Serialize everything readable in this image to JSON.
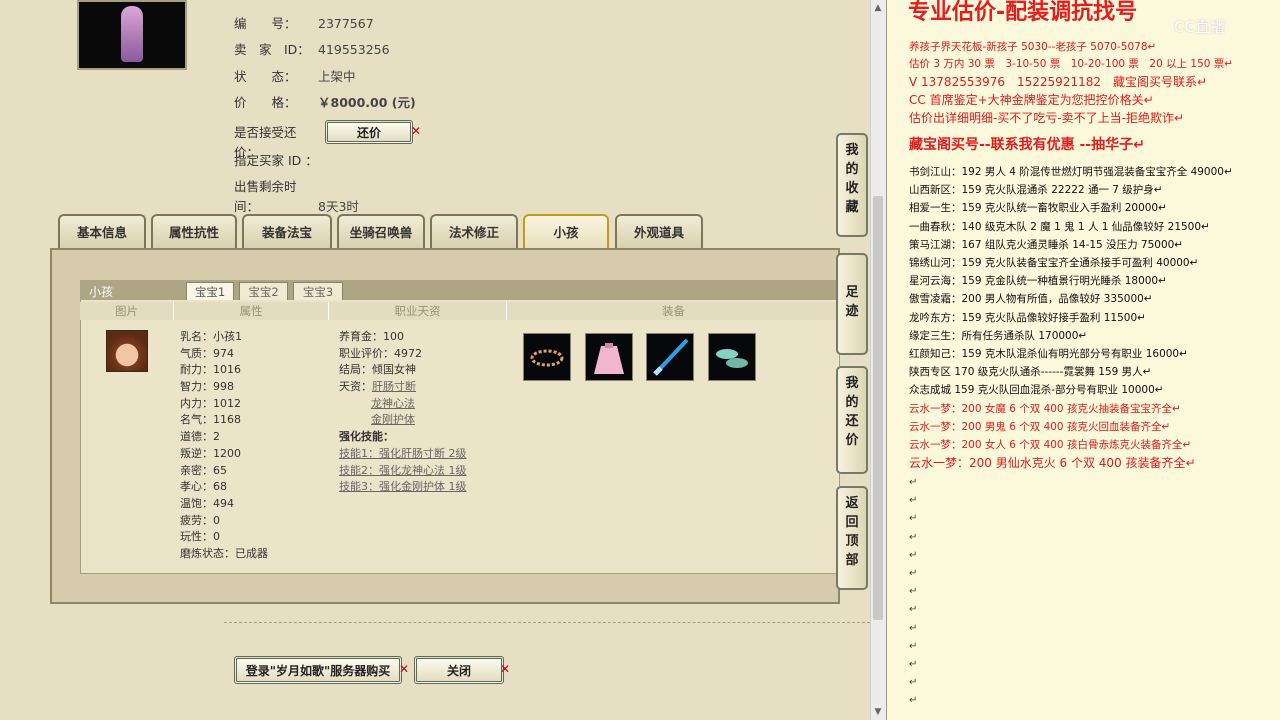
{
  "info": {
    "id_label": "编　　号：",
    "id_value": "2377567",
    "seller_label": "卖　家　ID：",
    "seller_value": "419553256",
    "status_label": "状　　态：",
    "status_value": "上架中",
    "price_label": "价　　格：",
    "price_value": "￥8000.00 (元)",
    "accept_label": "是否接受还价：",
    "counter_btn": "还价",
    "buyer_label": "指定买家 ID ：",
    "remain_label": "出售剩余时间：",
    "remain_value": "8天3时"
  },
  "tabs": [
    "基本信息",
    "属性抗性",
    "装备法宝",
    "坐骑召唤兽",
    "法术修正",
    "小孩",
    "外观道具"
  ],
  "panel": {
    "title": "小孩",
    "subtabs": [
      "宝宝1",
      "宝宝2",
      "宝宝3"
    ],
    "columns": [
      "图片",
      "属性",
      "职业天资",
      "装备"
    ]
  },
  "attributes": [
    "乳名：小孩1",
    "气质：974",
    "耐力：1016",
    "智力：998",
    "内力：1012",
    "名气：1168",
    "道德：2",
    "叛逆：1200",
    "亲密：65",
    "孝心：68",
    "温饱：494",
    "疲劳：0",
    "玩性：0",
    "磨炼状态：已成器"
  ],
  "career": {
    "upbringing": "养育金：100",
    "rating": "职业评价：4972",
    "ending": "结局：倾国女神",
    "talent_label": "天资：",
    "talents": [
      "肝肠寸断",
      "龙神心法",
      "金刚护体"
    ],
    "skill_label": "强化技能：",
    "skills": [
      "技能1：强化肝肠寸断 2级",
      "技能2：强化龙神心法 1级",
      "技能3：强化金刚护体 1级"
    ]
  },
  "side_buttons": [
    {
      "chars": [
        "我",
        "的",
        "收",
        "藏"
      ]
    },
    {
      "chars": [
        "足",
        "迹"
      ]
    },
    {
      "chars": [
        "我",
        "的",
        "还",
        "价"
      ]
    },
    {
      "chars": [
        "返",
        "回",
        "顶",
        "部"
      ]
    }
  ],
  "bottom": {
    "buy_btn": "登录\"岁月如歌\"服务器购买",
    "close_btn": "关闭"
  },
  "right": {
    "title": "专业估价-配装调抗找号",
    "watermark": "CC直播",
    "lines": [
      {
        "text": "养孩子界天花板-新孩子 5030--老孩子 5070-5078↵",
        "color": "red"
      },
      {
        "text": "估价 3 万内 30 票　3-10-50 票　10-20-100 票　20 以上 150 票↵",
        "color": "red"
      },
      {
        "text": "V 13782553976　15225921182　藏宝阁买号联系↵",
        "color": "red"
      },
      {
        "text": "CC 首席鉴定+大神金牌鉴定为您把控价格关↵",
        "color": "red"
      },
      {
        "text": "估价出详细明细-买不了吃亏-卖不了上当-拒绝欺诈↵",
        "color": "red"
      }
    ],
    "heading": "藏宝阁买号--联系我有优惠 --抽华子↵",
    "list": [
      {
        "text": "书剑江山：192 男人 4 阶混传世燃灯明节强混装备宝宝齐全 49000↵",
        "color": "black"
      },
      {
        "text": "山西新区：159 克火队混通杀 22222 通一 7 级护身↵",
        "color": "black"
      },
      {
        "text": "相爱一生：159 克火队统一畜牧职业入手盈利 20000↵",
        "color": "black"
      },
      {
        "text": "一曲春秋：140 级克木队 2 魔 1 鬼 1 人 1 仙品像较好 21500↵",
        "color": "black"
      },
      {
        "text": "策马江湖：167 组队克火通灵睡杀 14-15 没压力 75000↵",
        "color": "black"
      },
      {
        "text": "锦绣山河：159 克火队装备宝宝齐全通杀接手可盈利 40000↵",
        "color": "black"
      },
      {
        "text": "星河云海：159 克金队统一种植景行明光睡杀 18000↵",
        "color": "black"
      },
      {
        "text": "傲雪凌霜：200 男人物有所值，品像较好 335000↵",
        "color": "black"
      },
      {
        "text": "龙吟东方：159 克火队品像较好接手盈利 11500↵",
        "color": "black"
      },
      {
        "text": "缘定三生：所有任务通杀队 170000↵",
        "color": "black"
      },
      {
        "text": "红颜知己：159 克木队混杀仙有明光部分号有职业 16000↵",
        "color": "black"
      },
      {
        "text": "陕西专区 170 级克火队通杀------霓裳舞 159 男人↵",
        "color": "black"
      },
      {
        "text": "众志成城 159 克火队回血混杀-部分号有职业 10000↵",
        "color": "black"
      },
      {
        "text": "云水一梦：200 女魔 6 个双 400 孩克火抽装备宝宝齐全↵",
        "color": "red"
      },
      {
        "text": "云水一梦：200 男鬼 6 个双 400 孩克火回血装备齐全↵",
        "color": "red"
      },
      {
        "text": "云水一梦：200 女人 6 个双 400 孩白骨赤炼克火装备齐全↵",
        "color": "red"
      },
      {
        "text": "云水一梦：200 男仙水克火 6 个双 400 孩装备齐全↵",
        "color": "red"
      }
    ],
    "para_mark": "↵"
  }
}
